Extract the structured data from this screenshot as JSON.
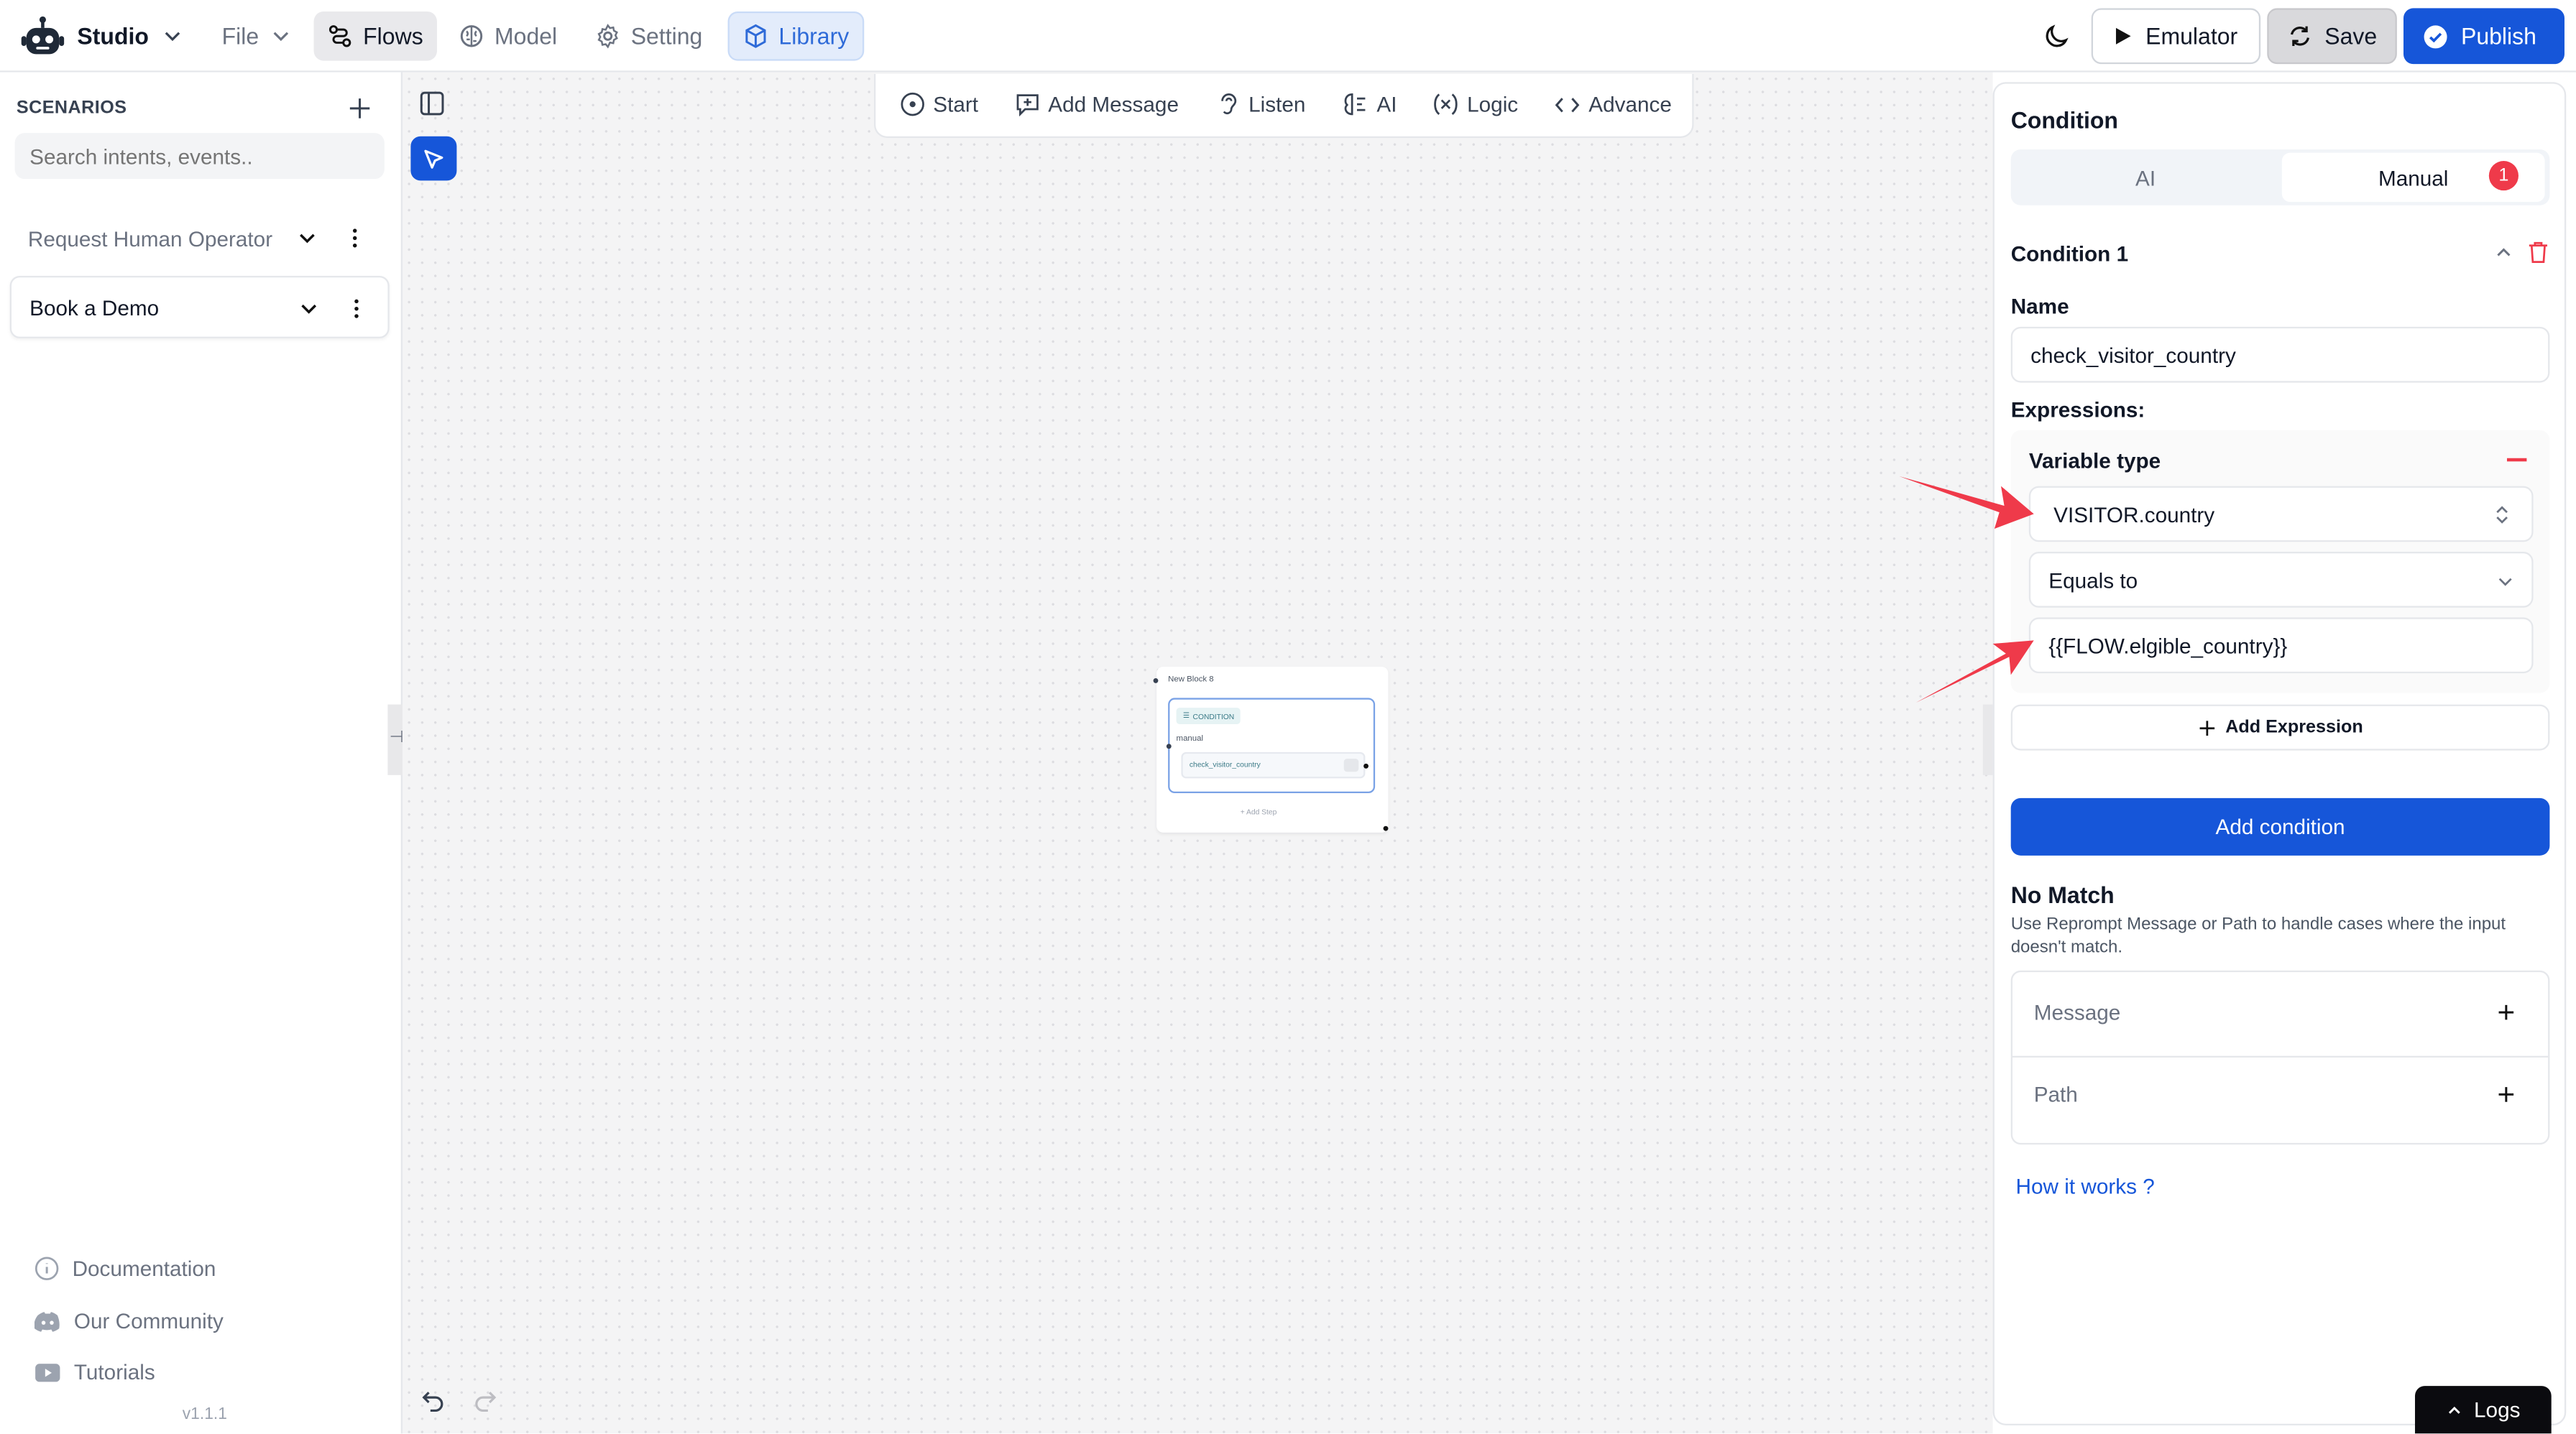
{
  "app": {
    "name": "Studio"
  },
  "nav": {
    "file": "File",
    "flows": "Flows",
    "model": "Model",
    "setting": "Setting",
    "library": "Library"
  },
  "actions": {
    "emulator": "Emulator",
    "save": "Save",
    "publish": "Publish"
  },
  "sidebar": {
    "heading": "SCENARIOS",
    "search_placeholder": "Search intents, events..",
    "scenarios": [
      {
        "label": "Request Human Operator"
      },
      {
        "label": "Book a Demo"
      }
    ],
    "footer": {
      "documentation": "Documentation",
      "community": "Our Community",
      "tutorials": "Tutorials",
      "version": "v1.1.1"
    }
  },
  "toolbar": {
    "start": "Start",
    "add_message": "Add Message",
    "listen": "Listen",
    "ai": "AI",
    "logic": "Logic",
    "advance": "Advance"
  },
  "block": {
    "title": "New Block 8",
    "type_tag": "CONDITION",
    "mode": "manual",
    "condition_name": "check_visitor_country",
    "add_step": "Add Step"
  },
  "panel": {
    "title": "Condition",
    "tabs": {
      "ai": "AI",
      "manual": "Manual",
      "manual_badge": "1"
    },
    "condition_title": "Condition 1",
    "name_label": "Name",
    "name_value": "check_visitor_country",
    "expressions_label": "Expressions:",
    "variable_type_label": "Variable type",
    "variable_value": "VISITOR.country",
    "operator_value": "Equals to",
    "compare_value": "{{FLOW.elgible_country}}",
    "add_expression": "Add Expression",
    "add_condition": "Add condition",
    "no_match_title": "No Match",
    "no_match_desc": "Use Reprompt Message or Path to handle cases where the input doesn't match.",
    "message_label": "Message",
    "path_label": "Path",
    "how_it_works": "How it works ?"
  },
  "logs": {
    "label": "Logs"
  },
  "colors": {
    "primary": "#1656d9",
    "accent_red": "#ef3a4a",
    "library_blue": "#2f6bd8"
  }
}
